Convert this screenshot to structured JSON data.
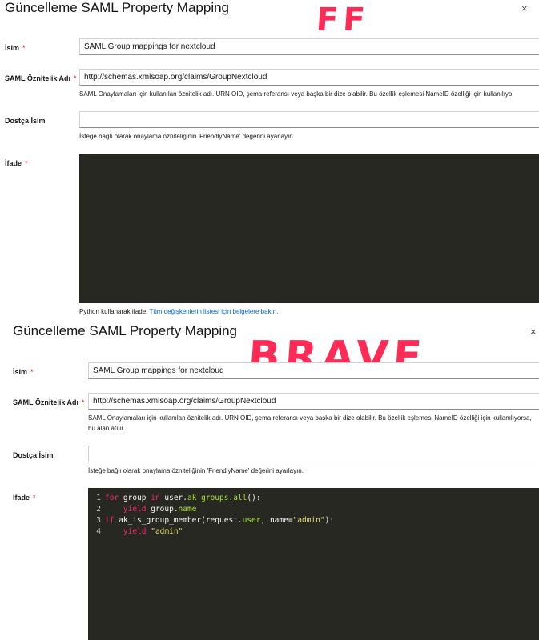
{
  "panels": {
    "ff": {
      "title": "Güncelleme SAML Property Mapping",
      "annotation": "FF",
      "name_label": "İsim",
      "name_value": "SAML Group mappings for nextcloud",
      "saml_label": "SAML Öznitelik Adı",
      "saml_value": "http://schemas.xmlsoap.org/claims/GroupNextcloud",
      "saml_help": "SAML Onaylamaları için kullanılan öznitelik adı. URN OID, şema referansı veya başka bir dize olabilir. Bu özellik eşlemesi NameID özelliği için kullanılıyo",
      "friendly_label": "Dostça İsim",
      "friendly_value": "",
      "friendly_help": "İsteğe bağlı olarak onaylama özniteliğinin 'FriendlyName' değerini ayarlayın.",
      "expr_label": "İfade",
      "expr_help_text": "Python kullanarak ifade.",
      "expr_help_link": "Tüm değişkenlerin listesi için belgelere bakın."
    },
    "brave": {
      "title": "Güncelleme SAML Property Mapping",
      "annotation": "BRAVE",
      "name_label": "İsim",
      "name_value": "SAML Group mappings for nextcloud",
      "saml_label": "SAML Öznitelik Adı",
      "saml_value": "http://schemas.xmlsoap.org/claims/GroupNextcloud",
      "saml_help": "SAML Onaylamaları için kullanılan öznitelik adı. URN OID, şema referansı veya başka bir dize olabilir. Bu özellik eşlemesi NameID özelliği için kullanılıyorsa, bu alan atılır.",
      "friendly_label": "Dostça İsim",
      "friendly_value": "",
      "friendly_help": "İsteğe bağlı olarak onaylama özniteliğinin 'FriendlyName' değerini ayarlayın.",
      "expr_label": "İfade",
      "code": {
        "n1": "1",
        "n2": "2",
        "n3": "3",
        "n4": "4",
        "l1_kw1": "for",
        "l1_a": " group ",
        "l1_kw2": "in",
        "l1_b": " user.",
        "l1_fn": "ak_groups",
        "l1_c": ".",
        "l1_fn2": "all",
        "l1_d": "():",
        "l2_ind": "    ",
        "l2_kw": "yield",
        "l2_a": " group.",
        "l2_fn": "name",
        "l3_kw": "if",
        "l3_a": " ak_is_group_member(request.",
        "l3_fn": "user",
        "l3_b": ", name=",
        "l3_st": "\"admin\"",
        "l3_c": "):",
        "l4_ind": "    ",
        "l4_kw": "yield",
        "l4_a": " ",
        "l4_st": "\"admin\""
      }
    }
  },
  "close_icon": "×",
  "required_mark": "*"
}
